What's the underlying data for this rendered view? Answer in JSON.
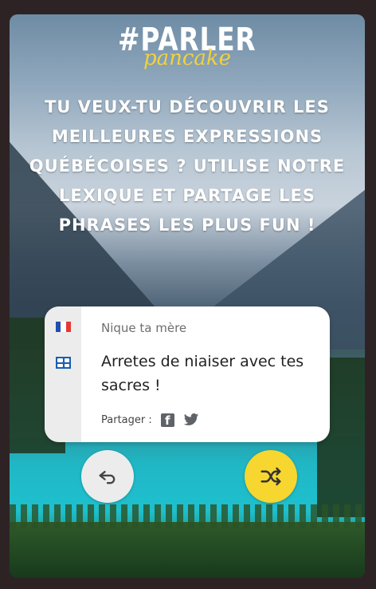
{
  "logo": {
    "main": "#PARLER",
    "sub": "pancake"
  },
  "headline": "TU VEUX-TU DÉCOUVRIR LES MEILLEURES EXPRESSIONS QUÉBÉCOISES ? UTILISE NOTRE LEXIQUE ET PARTAGE LES PHRASES LES PLUS FUN !",
  "card": {
    "french_phrase": "Nique ta mère",
    "quebec_phrase": "Arretes de niaiser avec tes sacres !",
    "share_label": "Partager :",
    "share_icons": [
      "facebook-icon",
      "twitter-icon"
    ]
  },
  "buttons": {
    "undo_icon": "undo-icon",
    "shuffle_icon": "shuffle-icon"
  },
  "colors": {
    "accent": "#f7d630",
    "logo_sub": "#f2d23b",
    "quebec_blue": "#1b5fb0"
  }
}
